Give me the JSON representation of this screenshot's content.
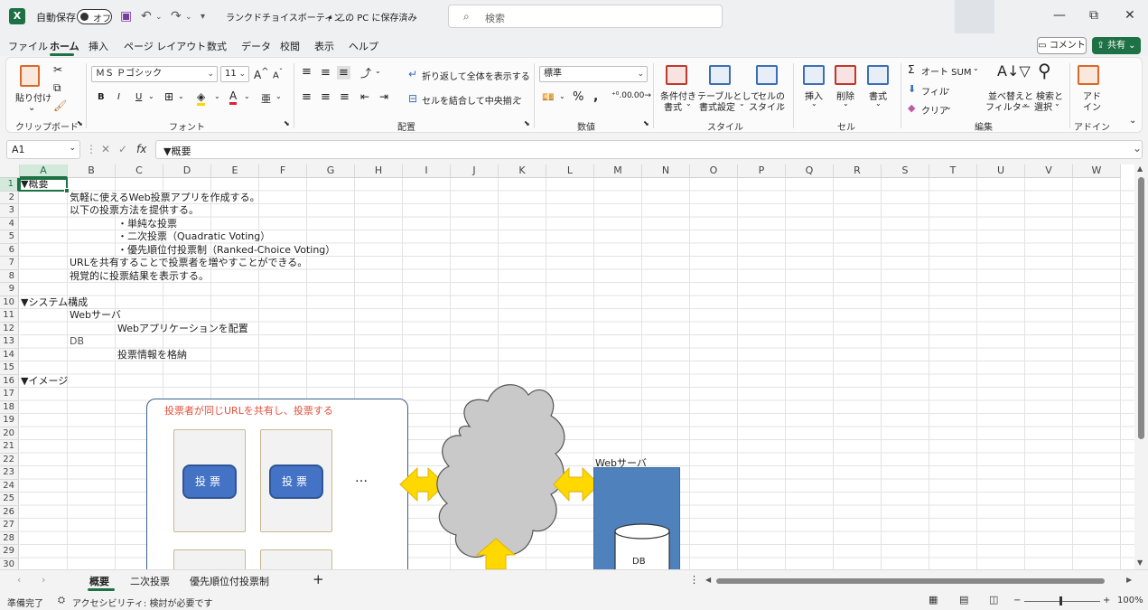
{
  "titlebar": {
    "autosave_label": "自動保存",
    "autosave_state": "オフ",
    "filename": "ランクドチョイスボーティン…",
    "save_location": "• この PC に保存済み",
    "search_placeholder": "検索"
  },
  "menu": {
    "items": [
      "ファイル",
      "ホーム",
      "挿入",
      "ページ レイアウト",
      "数式",
      "データ",
      "校閲",
      "表示",
      "ヘルプ"
    ],
    "active": "ホーム",
    "comment_label": "コメント",
    "share_label": "共有"
  },
  "ribbon": {
    "paste_label": "貼り付け",
    "font_name": "ＭＳ Ｐゴシック",
    "font_size": "11",
    "wrap_text_label": "折り返して全体を表示する",
    "merge_label": "セルを結合して中央揃え",
    "number_format": "標準",
    "cond_format_label1": "条件付き",
    "cond_format_label2": "書式",
    "table_format_label1": "テーブルとして",
    "table_format_label2": "書式設定",
    "cell_style_label1": "セルの",
    "cell_style_label2": "スタイル",
    "insert_label": "挿入",
    "delete_label": "削除",
    "format_label": "書式",
    "autosum_label": "オート SUM",
    "fill_label": "フィル",
    "clear_label": "クリア",
    "sort_label1": "並べ替えと",
    "sort_label2": "フィルター",
    "find_label1": "検索と",
    "find_label2": "選択",
    "addin_label1": "アド",
    "addin_label2": "イン",
    "groups": {
      "clipboard": "クリップボード",
      "font": "フォント",
      "alignment": "配置",
      "number": "数値",
      "styles": "スタイル",
      "cells": "セル",
      "editing": "編集",
      "addins": "アドイン"
    }
  },
  "formula_bar": {
    "name_box": "A1",
    "formula": "▼概要"
  },
  "grid": {
    "columns": [
      "A",
      "B",
      "C",
      "D",
      "E",
      "F",
      "G",
      "H",
      "I",
      "J",
      "K",
      "L",
      "M",
      "N",
      "O",
      "P",
      "Q",
      "R",
      "S",
      "T",
      "U",
      "V",
      "W"
    ],
    "rows": [
      "1",
      "2",
      "3",
      "4",
      "5",
      "6",
      "7",
      "8",
      "9",
      "10",
      "11",
      "12",
      "13",
      "14",
      "15",
      "16",
      "17",
      "18",
      "19",
      "20",
      "21",
      "22",
      "23",
      "24",
      "25",
      "26",
      "27",
      "28",
      "29",
      "30"
    ],
    "cells": {
      "A1": "▼概要",
      "B2": "気軽に使えるWeb投票アプリを作成する。",
      "B3": "以下の投票方法を提供する。",
      "C4": "・単純な投票",
      "C5": "・二次投票（Quadratic Voting）",
      "C6": "・優先順位付投票制（Ranked-Choice Voting）",
      "B7": "URLを共有することで投票者を増やすことができる。",
      "B8": "視覚的に投票結果を表示する。",
      "A10": "▼システム構成",
      "B11": "Webサーバ",
      "C12": "Webアプリケーションを配置",
      "B13": "DB",
      "C14": "投票情報を格納",
      "A16": "▼イメージ"
    }
  },
  "diagram": {
    "voters_label": "投票者が同じURLを共有し、投票する",
    "vote_button": "投票",
    "ellipsis": "…",
    "webserver_label": "Webサーバ",
    "db_label": "DB"
  },
  "sheets": {
    "tabs": [
      "概要",
      "二次投票",
      "優先順位付投票制"
    ],
    "active": "概要"
  },
  "status": {
    "ready": "準備完了",
    "accessibility": "アクセシビリティ: 検討が必要です",
    "zoom": "100%"
  },
  "colors": {
    "excel_green": "#1e7145",
    "diagram_blue": "#4472c4",
    "server_blue": "#4f81bd",
    "arrow_yellow": "#ffd800",
    "label_red": "#e0503a"
  }
}
